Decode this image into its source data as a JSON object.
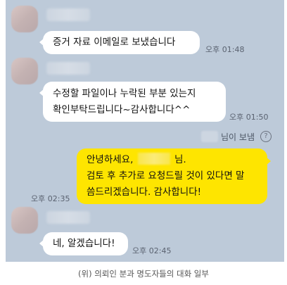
{
  "messages": [
    {
      "text": "증거 자료 이메일로 보냈습니다",
      "time": "오후 01:48"
    },
    {
      "line1": "수정할 파일이나 누락된 부분 있는지",
      "line2": "확인부탁드립니다~감사합니다^^",
      "time": "오후 01:50"
    },
    {
      "sender_suffix": "님이 보냄",
      "line1a": "안녕하세요, ",
      "line1b": " 님.",
      "line2": "검토 후 추가로 요청드릴 것이 있다면 말",
      "line3": "씀드리겠습니다. 감사합니다!",
      "time": "오후 02:35"
    },
    {
      "text": "네, 알겠습니다!",
      "time": "오후 02:45"
    }
  ],
  "icons": {
    "help": "question-circle-icon",
    "help_glyph": "?"
  },
  "caption": "(위) 의뢰인 분과 명도자들의 대화 일부",
  "colors": {
    "chat_bg": "#bdcad9",
    "outgoing_bubble": "#fee500",
    "incoming_bubble": "#ffffff"
  }
}
